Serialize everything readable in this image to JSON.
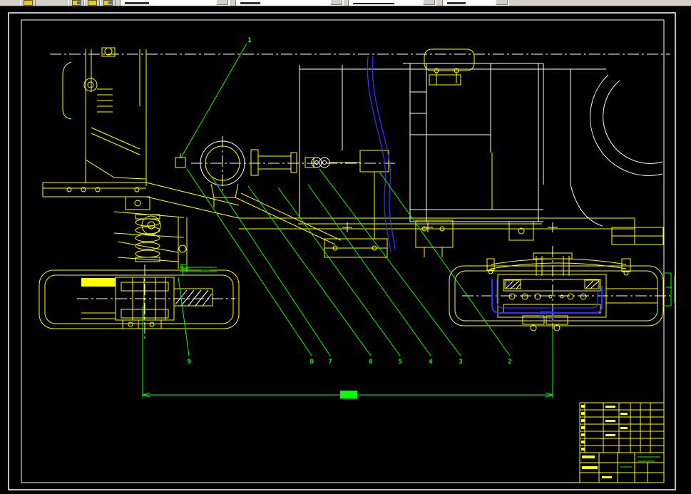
{
  "app": {
    "name": "cad-drawing-viewer"
  },
  "toolbar": {
    "controls": [
      {
        "name": "standard-button"
      },
      {
        "name": "icon-button-1"
      },
      {
        "name": "icon-button-2"
      },
      {
        "name": "icon-button-3"
      },
      {
        "name": "layer-combo"
      },
      {
        "name": "color-combo"
      },
      {
        "name": "linetype-combo"
      },
      {
        "name": "lineweight-combo"
      }
    ]
  },
  "callouts": {
    "top": "1",
    "bottom": [
      "9",
      "8",
      "7",
      "6",
      "5",
      "4",
      "3",
      "2"
    ]
  },
  "colors": {
    "background": "#000000",
    "line_primary": "#ffff00",
    "line_secondary": "#ffffff",
    "annotation_green": "#00ff00",
    "brake_hose_blue": "#3232ff",
    "toolbar_bg": "#d4d0c8"
  }
}
